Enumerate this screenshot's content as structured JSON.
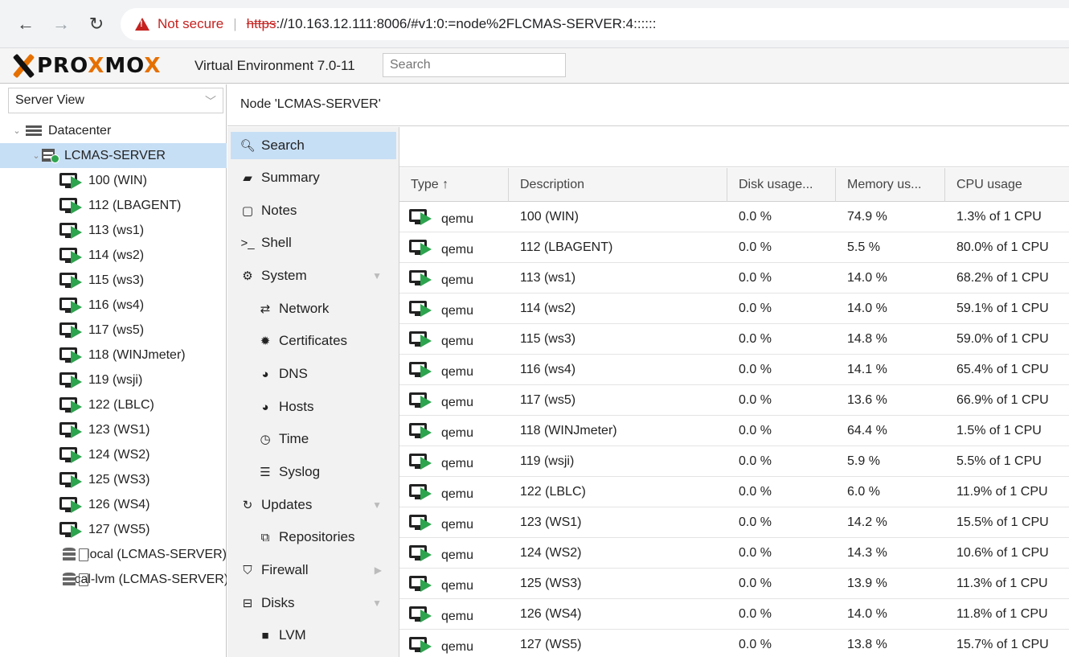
{
  "browser": {
    "not_secure": "Not secure",
    "url_scheme": "https",
    "url_rest": "://10.163.12.111:8006/#v1:0:=node%2FLCMAS-SERVER:4::::::"
  },
  "header": {
    "logo_part1": "PRO",
    "logo_x": "X",
    "logo_part2": "MO",
    "logo_end": "X",
    "version": "Virtual Environment 7.0-11",
    "search_placeholder": "Search"
  },
  "left": {
    "view": "Server View",
    "datacenter": "Datacenter",
    "node": "LCMAS-SERVER",
    "vms": [
      "100 (WIN)",
      "112 (LBAGENT)",
      "113 (ws1)",
      "114 (ws2)",
      "115 (ws3)",
      "116 (ws4)",
      "117 (ws5)",
      "118 (WINJmeter)",
      "119 (wsji)",
      "122 (LBLC)",
      "123 (WS1)",
      "124 (WS2)",
      "125 (WS3)",
      "126 (WS4)",
      "127 (WS5)"
    ],
    "storages": [
      "local (LCMAS-SERVER)",
      "local-lvm (LCMAS-SERVER)"
    ]
  },
  "node_title": "Node 'LCMAS-SERVER'",
  "nav": {
    "search": "Search",
    "summary": "Summary",
    "notes": "Notes",
    "shell": "Shell",
    "system": "System",
    "network": "Network",
    "certificates": "Certificates",
    "dns": "DNS",
    "hosts": "Hosts",
    "time": "Time",
    "syslog": "Syslog",
    "updates": "Updates",
    "repositories": "Repositories",
    "firewall": "Firewall",
    "disks": "Disks",
    "lvm": "LVM"
  },
  "grid": {
    "columns": [
      "Type ↑",
      "Description",
      "Disk usage...",
      "Memory us...",
      "CPU usage"
    ],
    "rows": [
      {
        "type": "qemu",
        "desc": "100 (WIN)",
        "disk": "0.0 %",
        "mem": "74.9 %",
        "cpu": "1.3% of 1 CPU"
      },
      {
        "type": "qemu",
        "desc": "112 (LBAGENT)",
        "disk": "0.0 %",
        "mem": "5.5 %",
        "cpu": "80.0% of 1 CPU"
      },
      {
        "type": "qemu",
        "desc": "113 (ws1)",
        "disk": "0.0 %",
        "mem": "14.0 %",
        "cpu": "68.2% of 1 CPU"
      },
      {
        "type": "qemu",
        "desc": "114 (ws2)",
        "disk": "0.0 %",
        "mem": "14.0 %",
        "cpu": "59.1% of 1 CPU"
      },
      {
        "type": "qemu",
        "desc": "115 (ws3)",
        "disk": "0.0 %",
        "mem": "14.8 %",
        "cpu": "59.0% of 1 CPU"
      },
      {
        "type": "qemu",
        "desc": "116 (ws4)",
        "disk": "0.0 %",
        "mem": "14.1 %",
        "cpu": "65.4% of 1 CPU"
      },
      {
        "type": "qemu",
        "desc": "117 (ws5)",
        "disk": "0.0 %",
        "mem": "13.6 %",
        "cpu": "66.9% of 1 CPU"
      },
      {
        "type": "qemu",
        "desc": "118 (WINJmeter)",
        "disk": "0.0 %",
        "mem": "64.4 %",
        "cpu": "1.5% of 1 CPU"
      },
      {
        "type": "qemu",
        "desc": "119 (wsji)",
        "disk": "0.0 %",
        "mem": "5.9 %",
        "cpu": "5.5% of 1 CPU"
      },
      {
        "type": "qemu",
        "desc": "122 (LBLC)",
        "disk": "0.0 %",
        "mem": "6.0 %",
        "cpu": "11.9% of 1 CPU"
      },
      {
        "type": "qemu",
        "desc": "123 (WS1)",
        "disk": "0.0 %",
        "mem": "14.2 %",
        "cpu": "15.5% of 1 CPU"
      },
      {
        "type": "qemu",
        "desc": "124 (WS2)",
        "disk": "0.0 %",
        "mem": "14.3 %",
        "cpu": "10.6% of 1 CPU"
      },
      {
        "type": "qemu",
        "desc": "125 (WS3)",
        "disk": "0.0 %",
        "mem": "13.9 %",
        "cpu": "11.3% of 1 CPU"
      },
      {
        "type": "qemu",
        "desc": "126 (WS4)",
        "disk": "0.0 %",
        "mem": "14.0 %",
        "cpu": "11.8% of 1 CPU"
      },
      {
        "type": "qemu",
        "desc": "127 (WS5)",
        "disk": "0.0 %",
        "mem": "13.8 %",
        "cpu": "15.7% of 1 CPU"
      }
    ]
  },
  "colors": {
    "accent_orange": "#e57000",
    "selection_blue": "#c7dff5",
    "running_green": "#2da44e",
    "warning_red": "#c5221f"
  }
}
